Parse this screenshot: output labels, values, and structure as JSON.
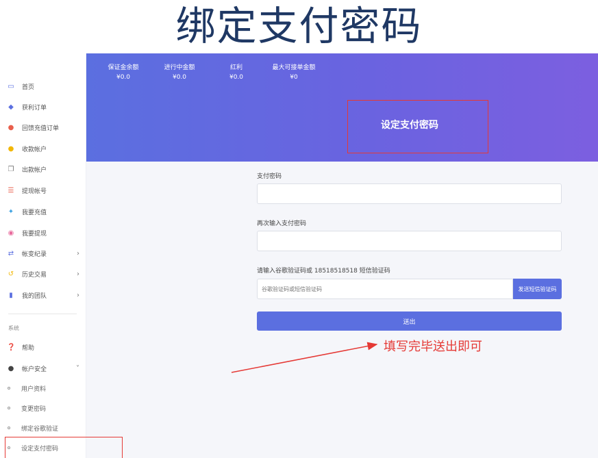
{
  "slide_title": "绑定支付密码",
  "sidebar": {
    "items": [
      {
        "label": "首页",
        "icon": "monitor-icon",
        "color": "#5b6fe0"
      },
      {
        "label": "获利订单",
        "icon": "tag-icon",
        "color": "#5b6fe0"
      },
      {
        "label": "回馈充值订单",
        "icon": "pin-icon",
        "color": "#e95f4c"
      },
      {
        "label": "收款帐户",
        "icon": "user-icon",
        "color": "#f2b705"
      },
      {
        "label": "出款帐户",
        "icon": "copy-icon",
        "color": "#777777"
      },
      {
        "label": "提现帐号",
        "icon": "list-icon",
        "color": "#e95f4c"
      },
      {
        "label": "我要充值",
        "icon": "sparkle-icon",
        "color": "#3aa0e0"
      },
      {
        "label": "我要提现",
        "icon": "coin-icon",
        "color": "#e86a9c"
      },
      {
        "label": "帐变纪录",
        "icon": "swap-icon",
        "color": "#5b6fe0"
      },
      {
        "label": "历史交易",
        "icon": "history-icon",
        "color": "#f2b705"
      },
      {
        "label": "我的团队",
        "icon": "bars-icon",
        "color": "#5b6fe0"
      }
    ],
    "section_label": "系统",
    "help": "帮助",
    "account_security": "帐户安全",
    "sub_items": [
      "用户资料",
      "变更密码",
      "绑定谷歌验证",
      "设定支付密码"
    ]
  },
  "banner": {
    "stats": [
      {
        "label": "保证金余额",
        "value": "¥0.0"
      },
      {
        "label": "进行中金额",
        "value": "¥0.0"
      },
      {
        "label": "红利",
        "value": "¥0.0"
      },
      {
        "label": "最大可接单金额",
        "value": "¥0"
      }
    ],
    "heading": "设定支付密码"
  },
  "form": {
    "password_label": "支付密码",
    "confirm_label": "再次输入支付密码",
    "code_label": "请输入谷歌验证码或 18518518518 短信验证码",
    "code_placeholder": "谷歌验证码或短信验证码",
    "sms_button": "发送短信验证码",
    "submit": "送出"
  },
  "annotation": "填写完毕送出即可",
  "colors": {
    "accent": "#5b6fe0",
    "highlight": "#e53935",
    "title": "#1f3864"
  }
}
